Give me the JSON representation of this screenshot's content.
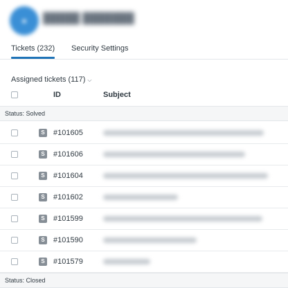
{
  "tabs": {
    "tickets": "Tickets (232)",
    "security": "Security Settings"
  },
  "view": {
    "title": "Assigned tickets (117)",
    "chevron": "⌵"
  },
  "table": {
    "columns": {
      "id": "ID",
      "subject": "Subject"
    },
    "groups": {
      "solved": "Status: Solved",
      "closed": "Status: Closed"
    },
    "status_badge": "S",
    "rows": [
      {
        "id": "#101605"
      },
      {
        "id": "#101606"
      },
      {
        "id": "#101604"
      },
      {
        "id": "#101602"
      },
      {
        "id": "#101599"
      },
      {
        "id": "#101590"
      },
      {
        "id": "#101579"
      }
    ]
  },
  "colors": {
    "accent": "#1f73b7",
    "avatar": "#3a8fd6",
    "badge": "#868e96"
  }
}
